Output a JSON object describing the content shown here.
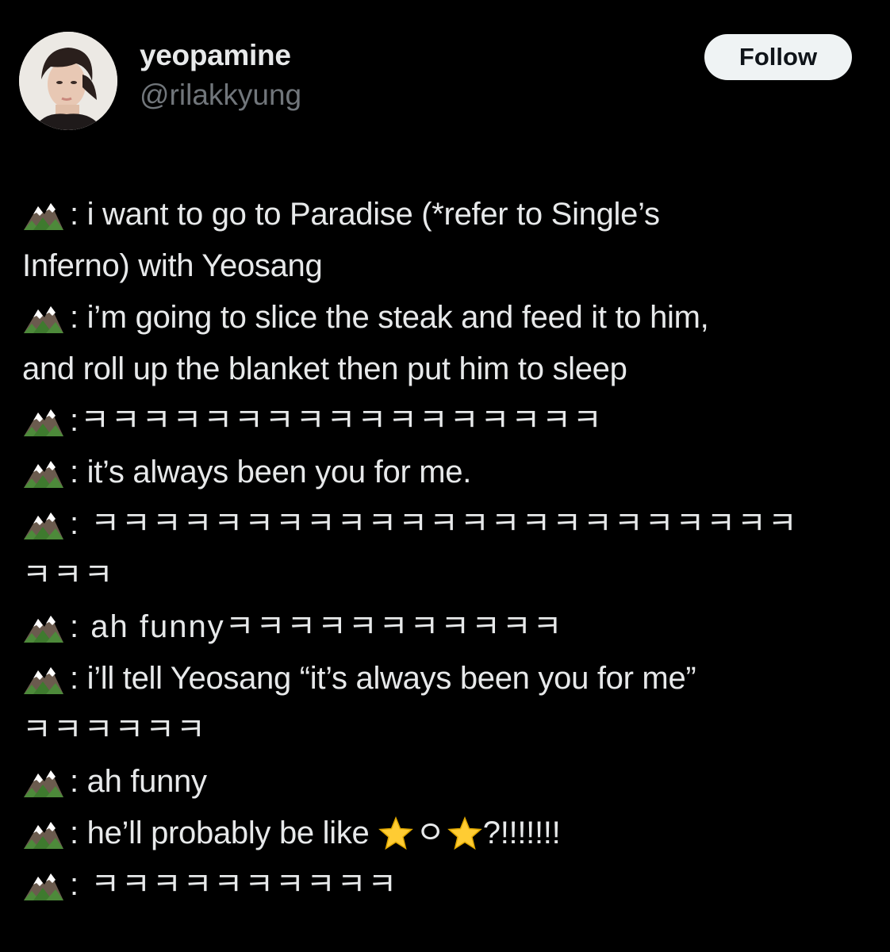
{
  "user": {
    "display_name": "yeopamine",
    "handle": "@rilakkyung",
    "follow_label": "Follow"
  },
  "tweet": {
    "lines": [
      {
        "icon": "mountain",
        "text": ": i want to go to Paradise (*refer to Single’s"
      },
      {
        "icon": null,
        "text": "Inferno) with Yeosang"
      },
      {
        "icon": "mountain",
        "text": ": i’m going to slice the steak and feed it to him,"
      },
      {
        "icon": null,
        "text": "and roll up the blanket then put him to sleep"
      },
      {
        "icon": "mountain",
        "text": ":ㅋㅋㅋㅋㅋㅋㅋㅋㅋㅋㅋㅋㅋㅋㅋㅋㅋ"
      },
      {
        "icon": "mountain",
        "text": ": it’s always been you for me."
      },
      {
        "icon": "mountain",
        "text": ": ㅋㅋㅋㅋㅋㅋㅋㅋㅋㅋㅋㅋㅋㅋㅋㅋㅋㅋㅋㅋㅋㅋㅋ"
      },
      {
        "icon": null,
        "text": "ㅋㅋㅋ"
      },
      {
        "icon": "mountain",
        "text": ": ah funnyㅋㅋㅋㅋㅋㅋㅋㅋㅋㅋㅋ"
      },
      {
        "icon": "mountain",
        "text": ": i’ll tell Yeosang “it’s always been you for me”"
      },
      {
        "icon": null,
        "text": "ㅋㅋㅋㅋㅋㅋ"
      },
      {
        "icon": "mountain",
        "text": ": ah funny"
      },
      {
        "icon": "mountain",
        "text_before": ": he’ll probably be like ",
        "middle": "ㅇ",
        "text_after": "?!!!!!!!",
        "stars": true
      },
      {
        "icon": "mountain",
        "text": ": ㅋㅋㅋㅋㅋㅋㅋㅋㅋㅋ"
      }
    ]
  },
  "colors": {
    "background": "#000000",
    "text": "#e7e9ea",
    "muted": "#71767b",
    "follow_bg": "#eff3f4",
    "follow_text": "#0f1419"
  }
}
